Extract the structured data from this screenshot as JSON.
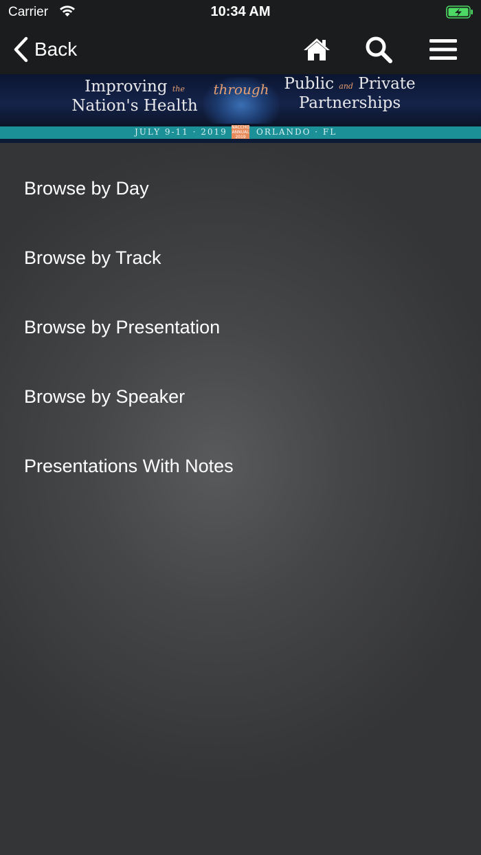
{
  "status_bar": {
    "carrier": "Carrier",
    "time": "10:34 AM",
    "icons": [
      "wifi-icon",
      "battery-charging-icon"
    ]
  },
  "nav": {
    "back_label": "Back",
    "icons": [
      "home-icon",
      "search-icon",
      "hamburger-menu-icon"
    ]
  },
  "banner": {
    "left_line1": "Improving",
    "left_small": "the",
    "left_line2": "Nation's Health",
    "middle": "through",
    "right_line1a": "Public",
    "right_small": "and",
    "right_line1b": "Private",
    "right_line2": "Partnerships",
    "dates": "JULY 9-11 · 2019",
    "badge_line1": "NACCHO",
    "badge_line2": "ANNUAL",
    "badge_line3": "2019",
    "location": "ORLANDO · FL"
  },
  "menu": {
    "items": [
      {
        "label": "Browse by Day"
      },
      {
        "label": "Browse by Track"
      },
      {
        "label": "Browse by Presentation"
      },
      {
        "label": "Browse by Speaker"
      },
      {
        "label": "Presentations With Notes"
      }
    ]
  },
  "colors": {
    "nav_background": "#1b1c1d",
    "banner_strip": "#1b9097",
    "accent_orange": "#e8a070",
    "battery_green": "#4cd964"
  }
}
